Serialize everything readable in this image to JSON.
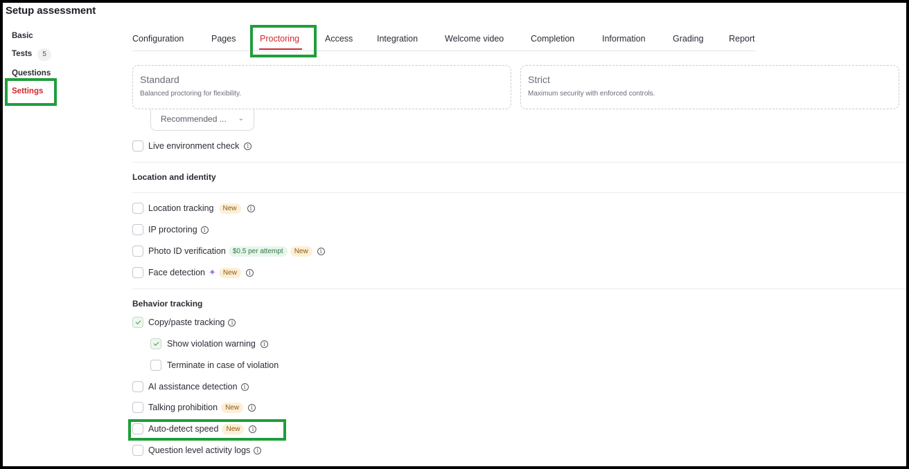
{
  "header": {
    "title": "Setup assessment"
  },
  "sidebar": {
    "items": [
      {
        "label": "Basic"
      },
      {
        "label": "Tests",
        "count": "5"
      },
      {
        "label": "Questions"
      },
      {
        "label": "Settings",
        "active": true
      }
    ]
  },
  "tabs": [
    {
      "label": "Configuration"
    },
    {
      "label": "Pages"
    },
    {
      "label": "Proctoring",
      "active": true
    },
    {
      "label": "Access"
    },
    {
      "label": "Integration"
    },
    {
      "label": "Welcome video"
    },
    {
      "label": "Completion"
    },
    {
      "label": "Information"
    },
    {
      "label": "Grading"
    },
    {
      "label": "Report"
    }
  ],
  "modes": [
    {
      "title": "Standard",
      "description": "Balanced proctoring for flexibility."
    },
    {
      "title": "Strict",
      "description": "Maximum security with enforced controls."
    }
  ],
  "dropdown": {
    "value": "Recommended ..."
  },
  "live_check": {
    "label": "Live environment check",
    "checked": false
  },
  "sections": {
    "location": {
      "title": "Location and identity",
      "items": [
        {
          "label": "Location tracking",
          "badge": "New",
          "checked": false
        },
        {
          "label": "IP proctoring",
          "checked": false
        },
        {
          "label": "Photo ID verification",
          "price": "$0.5 per attempt",
          "badge": "New",
          "checked": false
        },
        {
          "label": "Face detection",
          "badge": "New",
          "checked": false
        }
      ]
    },
    "behavior": {
      "title": "Behavior tracking",
      "items": [
        {
          "label": "Copy/paste tracking",
          "checked": true
        },
        {
          "label": "Show violation warning",
          "checked": true
        },
        {
          "label": "Terminate in case of violation",
          "checked": false
        },
        {
          "label": "AI assistance detection",
          "checked": false
        },
        {
          "label": "Talking prohibition",
          "badge": "New",
          "checked": false
        },
        {
          "label": "Auto-detect speed",
          "badge": "New",
          "checked": false
        },
        {
          "label": "Question level activity logs",
          "checked": false
        }
      ]
    }
  },
  "icons": {
    "info": "info-icon",
    "sparkle": "sparkle-icon",
    "chevron": "chevron-down-icon"
  },
  "colors": {
    "accent": "#d0282e",
    "highlight": "#1f9e3a"
  }
}
